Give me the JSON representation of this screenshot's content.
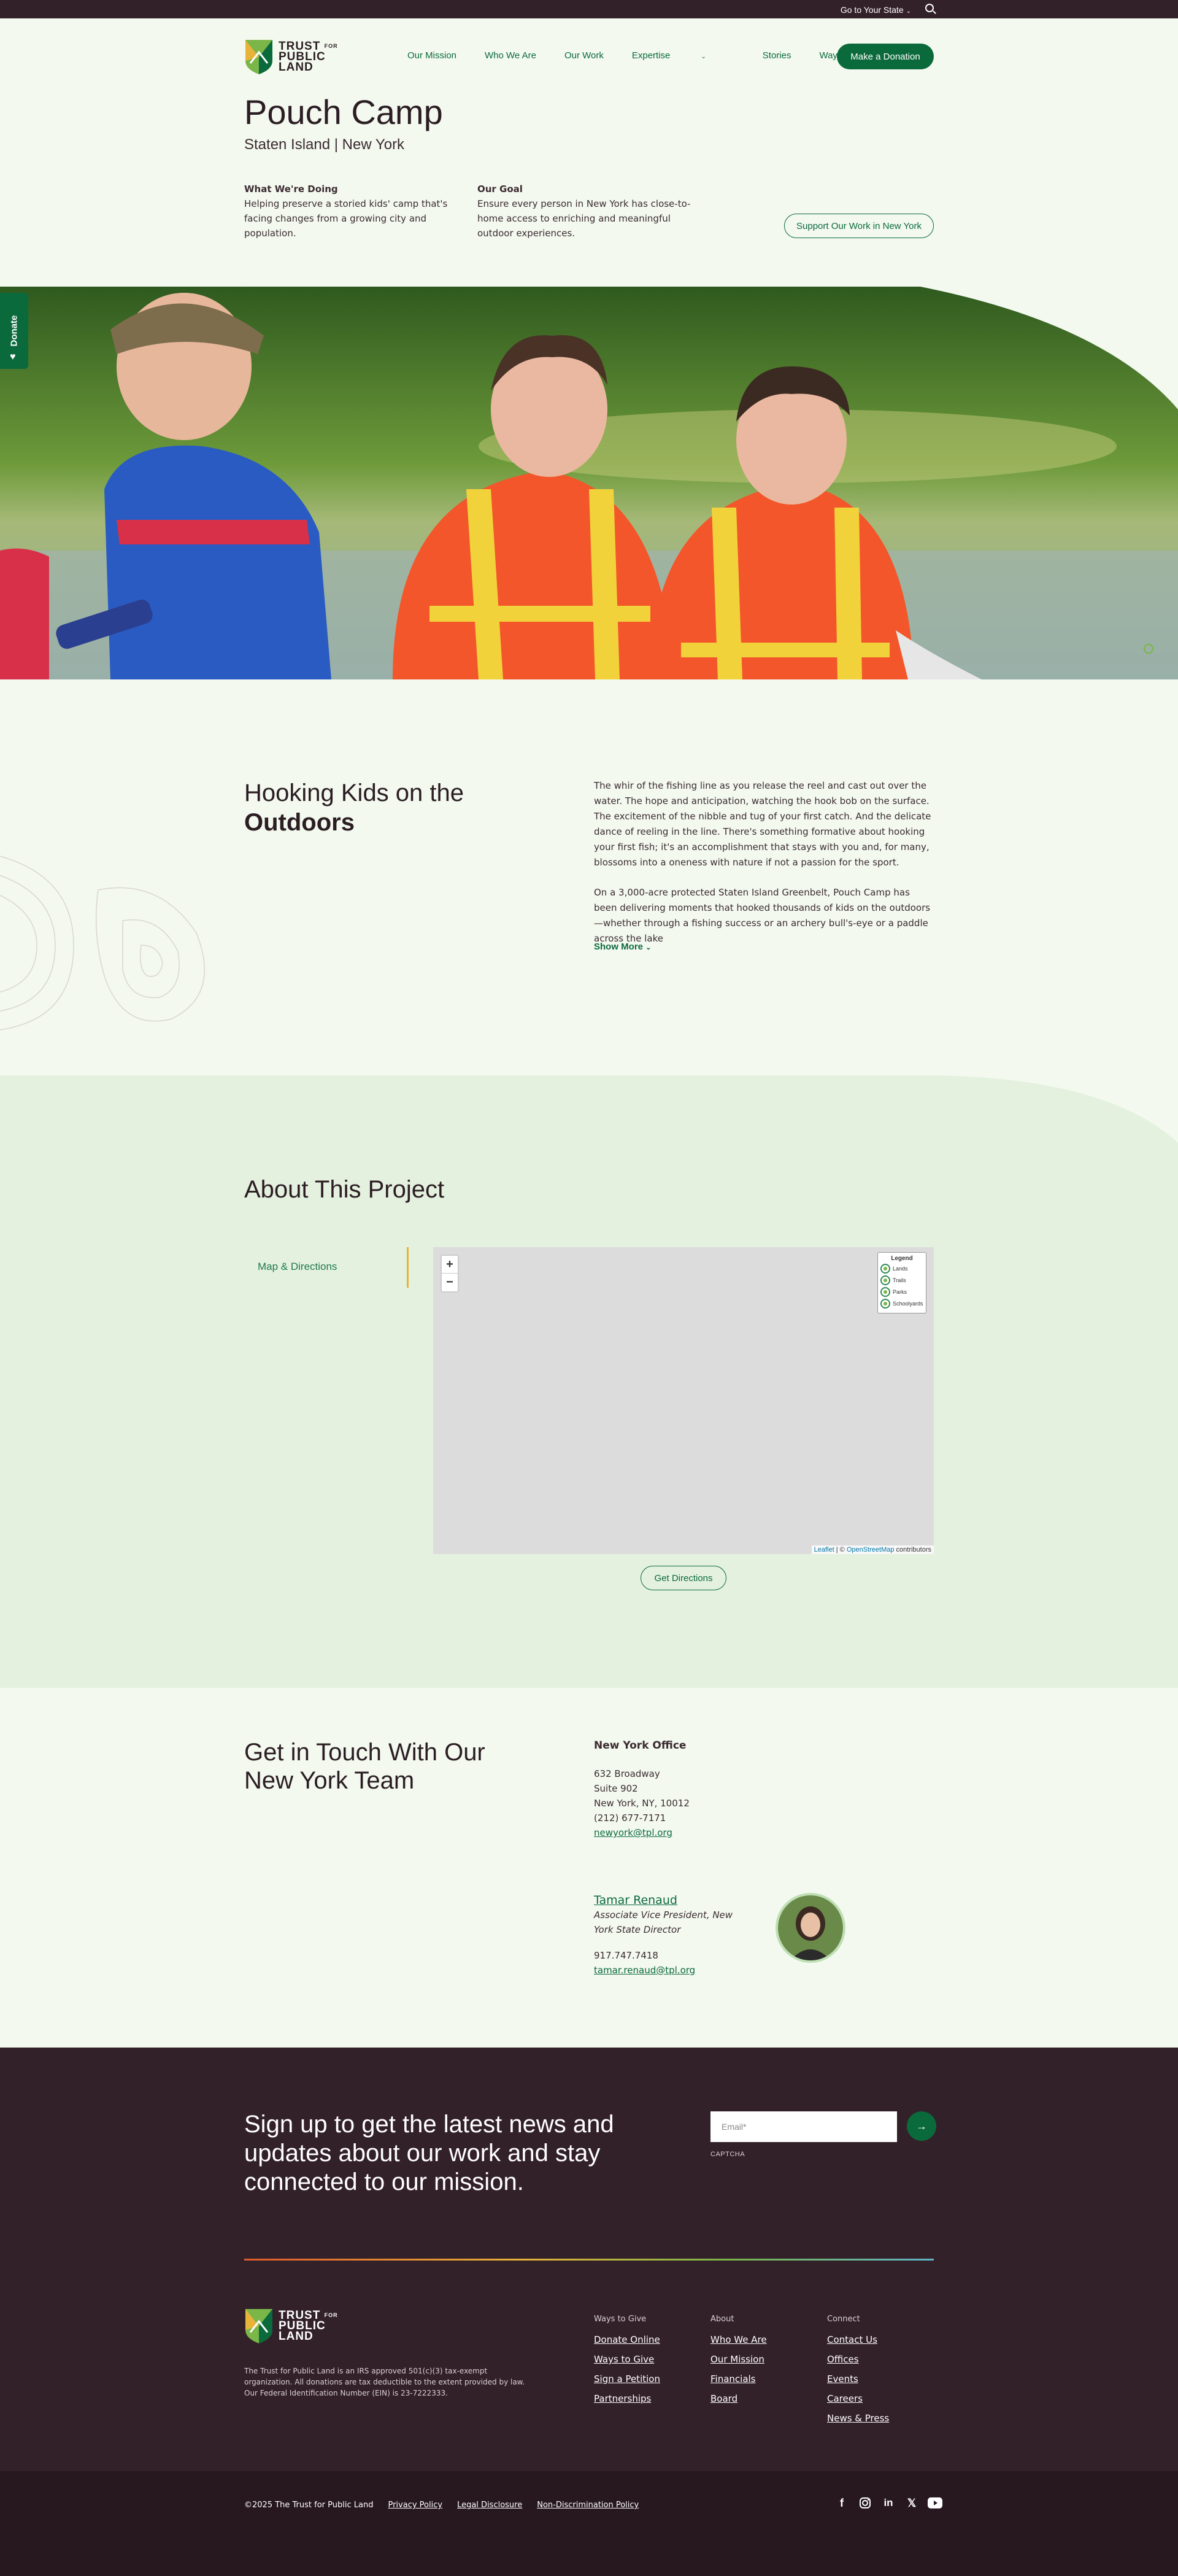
{
  "topbar": {
    "state_label": "Go to Your State"
  },
  "header": {
    "logo": {
      "line1": "TRUST",
      "for": "FOR",
      "line2": "PUBLIC",
      "line3": "LAND"
    },
    "nav": [
      {
        "label": "Our Mission"
      },
      {
        "label": "Who We Are"
      },
      {
        "label": "Our Work"
      },
      {
        "label": "Expertise"
      },
      {
        "label": "Stories"
      },
      {
        "label": "Ways to Give"
      }
    ],
    "donate_label": "Make a Donation"
  },
  "page": {
    "title": "Pouch Camp",
    "subtitle": "Staten Island | New York",
    "doing_heading": "What We're Doing",
    "doing_text": "Helping preserve a storied kids' camp that's facing changes from a growing city and population.",
    "goal_heading": "Our Goal",
    "goal_text": "Ensure every person in New York has close-to-home access to enriching and meaningful outdoor experiences.",
    "support_label": "Support Our Work in New York"
  },
  "side_donate": "Donate",
  "hook": {
    "title_line1": "Hooking Kids on the",
    "title_line2": "Outdoors",
    "p1": "The whir of the fishing line as you release the reel and cast out over the water. The hope and anticipation, watching the hook bob on the surface. The excitement of the nibble and tug of your first catch. And the delicate dance of reeling in the line. There's something formative about hooking your first fish; it's an accomplishment that stays with you and, for many, blossoms into a oneness with nature if not a passion for the sport.",
    "p2": "On a 3,000-acre protected Staten Island Greenbelt, Pouch Camp has been delivering moments that hooked thousands of kids on the outdoors—whether through a fishing success or an archery bull's-eye or a paddle across the lake",
    "show_more": "Show More"
  },
  "about": {
    "title": "About This Project",
    "tab_label": "Map & Directions",
    "legend_title": "Legend",
    "legend_items": [
      {
        "label": "Lands"
      },
      {
        "label": "Trails"
      },
      {
        "label": "Parks"
      },
      {
        "label": "Schoolyards"
      }
    ],
    "attrib_leaflet": "Leaflet",
    "attrib_sep": " | © ",
    "attrib_osm": "OpenStreetMap",
    "attrib_tail": " contributors",
    "directions_label": "Get Directions"
  },
  "contact": {
    "title": "Get in Touch With Our New York Team",
    "office_heading": "New York Office",
    "address1": "632 Broadway",
    "address2": "Suite 902",
    "address3": "New York, NY, 10012",
    "phone": "(212) 677-7171",
    "email": "newyork@tpl.org",
    "person_name": "Tamar Renaud",
    "person_role": "Associate Vice President, New York State Director",
    "person_phone": "917.747.7418",
    "person_email": "tamar.renaud@tpl.org"
  },
  "footer": {
    "signup_title": "Sign up to get the latest news and updates about our work and stay connected to our mission.",
    "email_placeholder": "Email*",
    "captcha": "CAPTCHA",
    "irs_text": "The Trust for Public Land is an IRS approved 501(c)(3) tax-exempt organization. All donations are tax deductible to the extent provided by law. Our Federal Identification Number (EIN) is 23-7222333.",
    "cols": [
      {
        "heading": "Ways to Give",
        "links": [
          "Donate Online",
          "Ways to Give",
          "Sign a Petition",
          "Partnerships"
        ]
      },
      {
        "heading": "About",
        "links": [
          "Who We Are",
          "Our Mission",
          "Financials",
          "Board"
        ]
      },
      {
        "heading": "Connect",
        "links": [
          "Contact Us",
          "Offices",
          "Events",
          "Careers",
          "News & Press"
        ]
      }
    ],
    "copyright": "©2025 The Trust for Public Land",
    "privacy": "Privacy Policy",
    "legal": "Legal Disclosure",
    "nondisc": "Non-Discrimination Policy"
  },
  "colors": {
    "brand_green": "#0b6a3c",
    "footer_bg": "#33212a",
    "page_bg": "#f3f9ef",
    "about_bg": "#e4f1df"
  }
}
